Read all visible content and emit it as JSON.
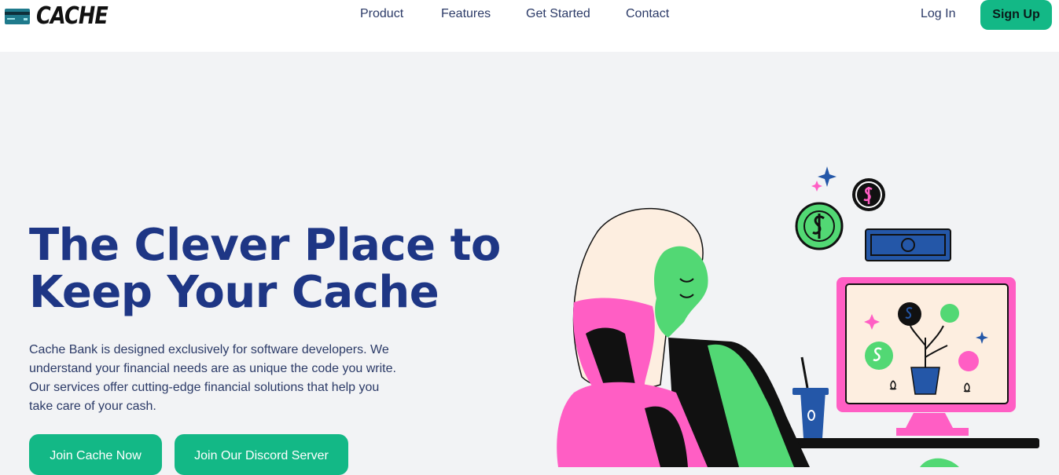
{
  "brand": {
    "name": "CACHE",
    "icon": "credit-card-icon"
  },
  "nav": {
    "links": [
      "Product",
      "Features",
      "Get Started",
      "Contact"
    ],
    "login": "Log In",
    "signup": "Sign Up"
  },
  "hero": {
    "title_line1": "The Clever Place to",
    "title_line2": "Keep Your Cache",
    "description": "Cache Bank is designed exclusively for software developers. We understand your financial needs are as unique the code you write. Our services offer cutting-edge financial solutions that help you take care of your cash.",
    "primary_button": "Join Cache Now",
    "secondary_button": "Join Our Discord Server"
  },
  "colors": {
    "accent": "#13b886",
    "heading": "#1e3685",
    "text": "#2b3a67",
    "background": "#f2f3f5",
    "pink": "#ff5ec4",
    "green": "#52d874",
    "blue": "#2457a8"
  }
}
